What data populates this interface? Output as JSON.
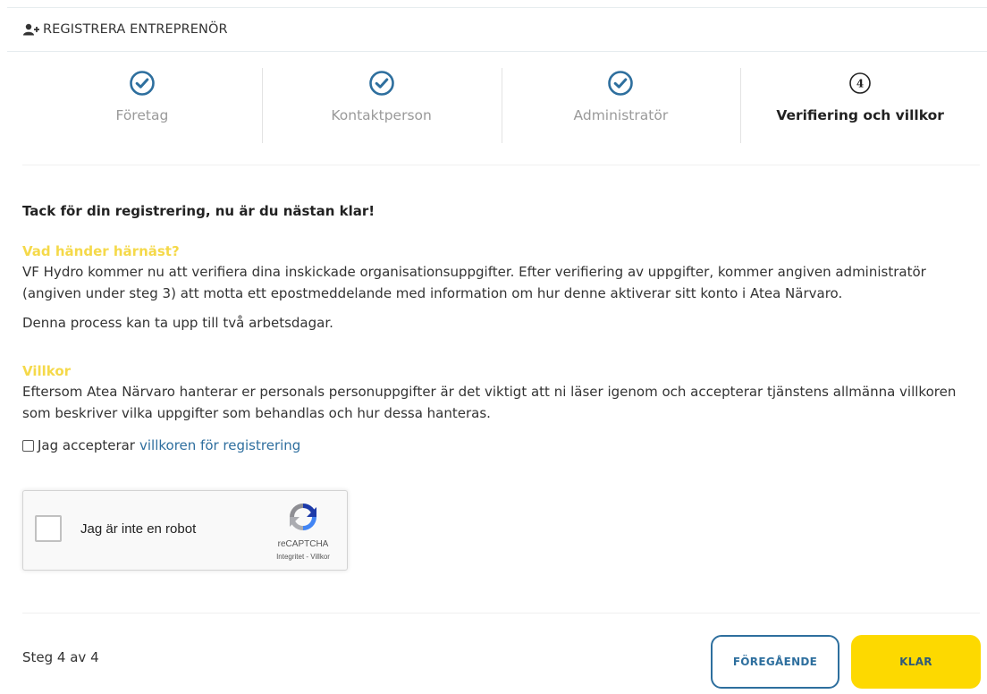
{
  "header": {
    "icon": "add-user-icon",
    "title": "REGISTRERA ENTREPRENÖR"
  },
  "steps": [
    {
      "label": "Företag",
      "state": "completed",
      "icon": "check-circle-icon"
    },
    {
      "label": "Kontaktperson",
      "state": "completed",
      "icon": "check-circle-icon"
    },
    {
      "label": "Administratör",
      "state": "completed",
      "icon": "check-circle-icon"
    },
    {
      "label": "Verifiering och villkor",
      "state": "active",
      "number": "4"
    }
  ],
  "content": {
    "thanks": "Tack för din registrering, nu är du nästan klar!",
    "next_heading": "Vad händer härnäst?",
    "next_text": "VF Hydro kommer nu att verifiera dina inskickade organisationsuppgifter. Efter verifiering av uppgifter, kommer angiven administratör (angiven under steg 3) att motta ett epostmeddelande med information om hur denne aktiverar sitt konto i Atea Närvaro.",
    "process_text": "Denna process kan ta upp till två arbetsdagar.",
    "terms_heading": "Villkor",
    "terms_text": "Eftersom Atea Närvaro hanterar er personals personuppgifter är det viktigt att ni läser igenom och accepterar tjänstens allmänna villkoren som beskriver vilka uppgifter som behandlas och hur dessa hanteras.",
    "accept_prefix": "Jag accepterar",
    "accept_link": "villkoren för registrering"
  },
  "captcha": {
    "label": "Jag är inte en robot",
    "brand": "reCAPTCHA",
    "links": "Integritet - Villkor"
  },
  "footer": {
    "step_count": "Steg 4 av 4",
    "prev_label": "FÖREGÅENDE",
    "done_label": "KLAR"
  },
  "colors": {
    "accent_blue": "#2e6f9e",
    "heading_yellow": "#f5d94a",
    "button_yellow": "#fdd900"
  }
}
